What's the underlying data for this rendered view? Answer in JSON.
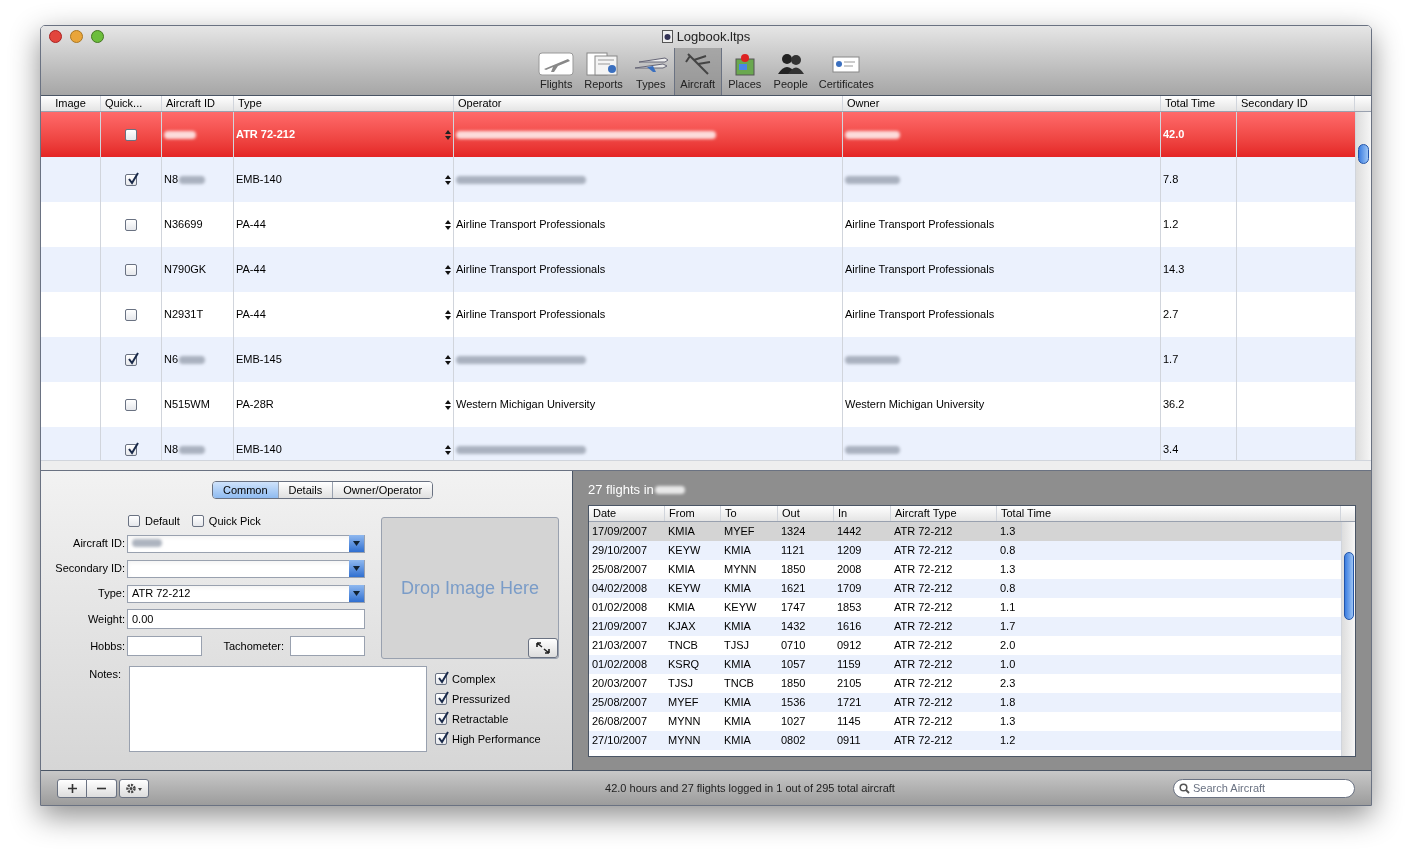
{
  "window": {
    "title": "Logbook.ltps"
  },
  "toolbar": [
    {
      "label": "Flights",
      "kind": "flights",
      "selected": false
    },
    {
      "label": "Reports",
      "kind": "reports",
      "selected": false
    },
    {
      "label": "Types",
      "kind": "types",
      "selected": false
    },
    {
      "label": "Aircraft",
      "kind": "aircraft",
      "selected": true
    },
    {
      "label": "Places",
      "kind": "places",
      "selected": false
    },
    {
      "label": "People",
      "kind": "people",
      "selected": false
    },
    {
      "label": "Certificates",
      "kind": "certificates",
      "selected": false
    }
  ],
  "aircraft_table": {
    "columns": [
      "Image",
      "Quick...",
      "Aircraft ID",
      "Type",
      "Operator",
      "Owner",
      "Total Time",
      "Secondary ID"
    ],
    "rows": [
      {
        "selected": true,
        "quick_pick": false,
        "id_blurred": true,
        "type": "ATR 72-212",
        "total_time": "42.0"
      },
      {
        "selected": false,
        "quick_pick": true,
        "aircraft_id": "N8",
        "id_blurred": true,
        "type": "EMB-140",
        "total_time": "7.8"
      },
      {
        "selected": false,
        "quick_pick": false,
        "aircraft_id": "N36699",
        "type": "PA-44",
        "operator": "Airline Transport Professionals",
        "owner": "Airline Transport Professionals",
        "total_time": "1.2"
      },
      {
        "selected": false,
        "quick_pick": false,
        "aircraft_id": "N790GK",
        "type": "PA-44",
        "operator": "Airline Transport Professionals",
        "owner": "Airline Transport Professionals",
        "total_time": "14.3"
      },
      {
        "selected": false,
        "quick_pick": false,
        "aircraft_id": "N2931T",
        "type": "PA-44",
        "operator": "Airline Transport Professionals",
        "owner": "Airline Transport Professionals",
        "total_time": "2.7"
      },
      {
        "selected": false,
        "quick_pick": true,
        "aircraft_id": "N6",
        "id_blurred": true,
        "type": "EMB-145",
        "total_time": "1.7"
      },
      {
        "selected": false,
        "quick_pick": false,
        "aircraft_id": "N515WM",
        "type": "PA-28R",
        "operator": "Western Michigan University",
        "owner": "Western Michigan University",
        "total_time": "36.2"
      },
      {
        "selected": false,
        "quick_pick": true,
        "aircraft_id": "N8",
        "id_blurred": true,
        "type": "EMB-140",
        "total_time": "3.4"
      }
    ]
  },
  "detail": {
    "tabs": [
      {
        "label": "Common",
        "selected": true
      },
      {
        "label": "Details",
        "selected": false
      },
      {
        "label": "Owner/Operator",
        "selected": false
      }
    ],
    "flags": [
      {
        "label": "Default",
        "checked": false
      },
      {
        "label": "Quick Pick",
        "checked": false
      }
    ],
    "aircraft_id": {
      "label": "Aircraft ID:"
    },
    "secondary_id": {
      "label": "Secondary ID:"
    },
    "type": {
      "label": "Type:",
      "value": "ATR 72-212"
    },
    "weight": {
      "label": "Weight:",
      "value": "0.00"
    },
    "hobbs": {
      "label": "Hobbs:"
    },
    "tachometer": {
      "label": "Tachometer:"
    },
    "notes": {
      "label": "Notes:"
    },
    "image_drop": "Drop Image Here",
    "attributes": [
      {
        "label": "Complex",
        "checked": true
      },
      {
        "label": "Pressurized",
        "checked": true
      },
      {
        "label": "Retractable",
        "checked": true
      },
      {
        "label": "High Performance",
        "checked": true
      }
    ]
  },
  "flights": {
    "title": "27 flights in",
    "columns": [
      "Date",
      "From",
      "To",
      "Out",
      "In",
      "Aircraft Type",
      "Total Time"
    ],
    "rows": [
      {
        "selected": true,
        "cells": [
          "17/09/2007",
          "KMIA",
          "MYEF",
          "1324",
          "1442",
          "ATR 72-212",
          "1.3"
        ]
      },
      {
        "selected": false,
        "cells": [
          "29/10/2007",
          "KEYW",
          "KMIA",
          "1121",
          "1209",
          "ATR 72-212",
          "0.8"
        ]
      },
      {
        "selected": false,
        "cells": [
          "25/08/2007",
          "KMIA",
          "MYNN",
          "1850",
          "2008",
          "ATR 72-212",
          "1.3"
        ]
      },
      {
        "selected": false,
        "cells": [
          "04/02/2008",
          "KEYW",
          "KMIA",
          "1621",
          "1709",
          "ATR 72-212",
          "0.8"
        ]
      },
      {
        "selected": false,
        "cells": [
          "01/02/2008",
          "KMIA",
          "KEYW",
          "1747",
          "1853",
          "ATR 72-212",
          "1.1"
        ]
      },
      {
        "selected": false,
        "cells": [
          "21/09/2007",
          "KJAX",
          "KMIA",
          "1432",
          "1616",
          "ATR 72-212",
          "1.7"
        ]
      },
      {
        "selected": false,
        "cells": [
          "21/03/2007",
          "TNCB",
          "TJSJ",
          "0710",
          "0912",
          "ATR 72-212",
          "2.0"
        ]
      },
      {
        "selected": false,
        "cells": [
          "01/02/2008",
          "KSRQ",
          "KMIA",
          "1057",
          "1159",
          "ATR 72-212",
          "1.0"
        ]
      },
      {
        "selected": false,
        "cells": [
          "20/03/2007",
          "TJSJ",
          "TNCB",
          "1850",
          "2105",
          "ATR 72-212",
          "2.3"
        ]
      },
      {
        "selected": false,
        "cells": [
          "25/08/2007",
          "MYEF",
          "KMIA",
          "1536",
          "1721",
          "ATR 72-212",
          "1.8"
        ]
      },
      {
        "selected": false,
        "cells": [
          "26/08/2007",
          "MYNN",
          "KMIA",
          "1027",
          "1145",
          "ATR 72-212",
          "1.3"
        ]
      },
      {
        "selected": false,
        "cells": [
          "27/10/2007",
          "MYNN",
          "KMIA",
          "0802",
          "0911",
          "ATR 72-212",
          "1.2"
        ]
      }
    ]
  },
  "status_bar": {
    "text": "42.0 hours and 27 flights logged in 1 out of 295 total aircraft",
    "search_placeholder": "Search Aircraft"
  }
}
